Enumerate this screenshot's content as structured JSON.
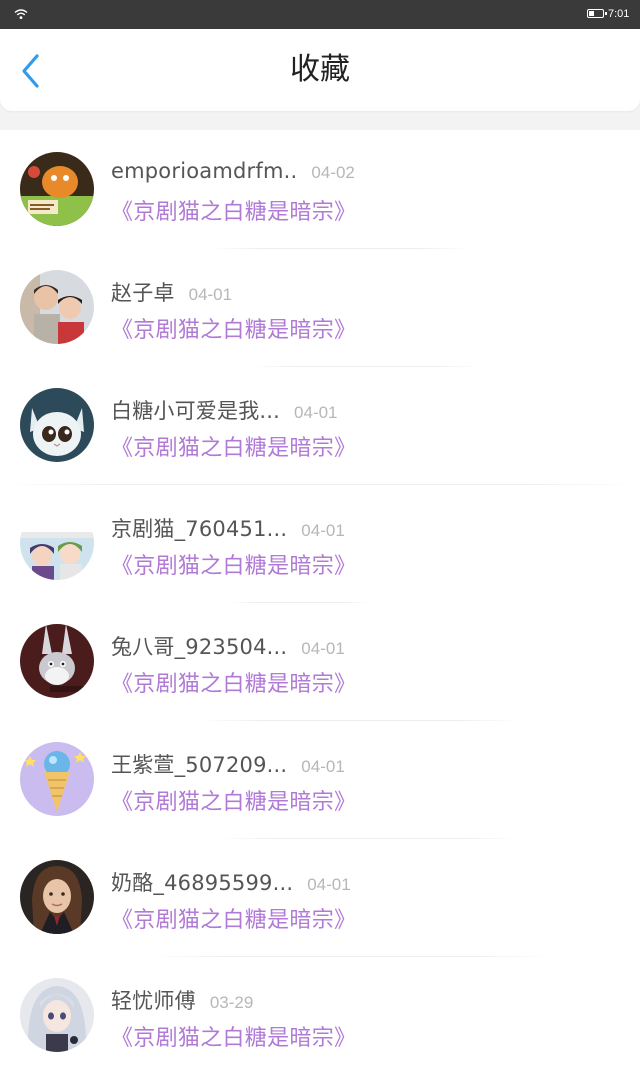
{
  "status_bar": {
    "time": "7:01",
    "battery_icon": "battery-low-icon",
    "wifi_icon": "wifi-icon"
  },
  "header": {
    "title": "收藏",
    "back_icon": "chevron-left-icon",
    "accent_color": "#2f9bee"
  },
  "items": [
    {
      "name": "emporioamdrfm..",
      "date": "04-02",
      "work": "《京剧猫之白糖是暗宗》",
      "avatar": "cartoon-orange"
    },
    {
      "name": "赵子卓",
      "date": "04-01",
      "work": "《京剧猫之白糖是暗宗》",
      "avatar": "kids-photo"
    },
    {
      "name": "白糖小可爱是我...",
      "date": "04-01",
      "work": "《京剧猫之白糖是暗宗》",
      "avatar": "white-cat"
    },
    {
      "name": "京剧猫_760451...",
      "date": "04-01",
      "work": "《京剧猫之白糖是暗宗》",
      "avatar": "anime-group"
    },
    {
      "name": "兔八哥_923504...",
      "date": "04-01",
      "work": "《京剧猫之白糖是暗宗》",
      "avatar": "bugs-bunny"
    },
    {
      "name": "王紫萱_507209...",
      "date": "04-01",
      "work": "《京剧猫之白糖是暗宗》",
      "avatar": "ice-cream-globe"
    },
    {
      "name": "奶酪_46895599...",
      "date": "04-01",
      "work": "《京剧猫之白糖是暗宗》",
      "avatar": "girl-portrait"
    },
    {
      "name": "轻忧师傅",
      "date": "03-29",
      "work": "《京剧猫之白糖是暗宗》",
      "avatar": "anime-silver-hair"
    }
  ],
  "colors": {
    "work_title": "#b07ad6",
    "name": "#555555",
    "date": "#b7b7b7"
  }
}
